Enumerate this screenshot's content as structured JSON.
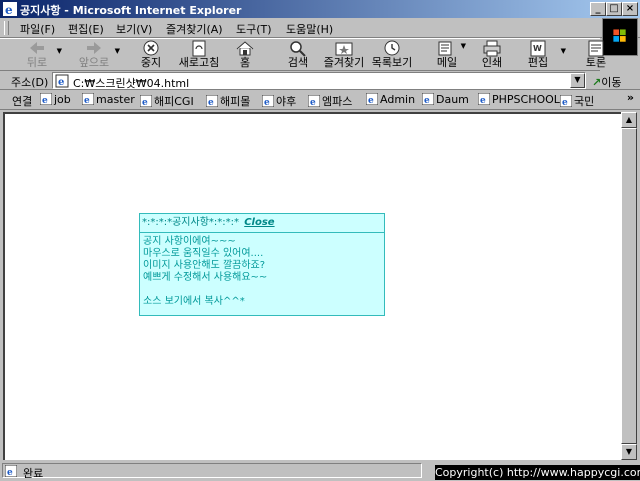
{
  "window": {
    "title": "공지사항 - Microsoft Internet Explorer",
    "minimize": "_",
    "maximize": "□",
    "close": "×"
  },
  "menu": [
    "파일(F)",
    "편집(E)",
    "보기(V)",
    "즐겨찾기(A)",
    "도구(T)",
    "도움말(H)"
  ],
  "toolbar": {
    "back": "뒤로",
    "forward": "앞으로",
    "stop": "중지",
    "refresh": "새로고침",
    "home": "홈",
    "search": "검색",
    "favorites": "즐겨찾기",
    "history": "목록보기",
    "mail": "메일",
    "print": "인쇄",
    "edit": "편집",
    "discuss": "토론"
  },
  "address": {
    "label": "주소(D)",
    "url": "C:₩스크린샷₩04.html",
    "go_label": "이동"
  },
  "links": {
    "label": "연결",
    "items": [
      "job",
      "master",
      "해피CGI",
      "해피몰",
      "야후",
      "엠파스",
      "Admin",
      "Daum",
      "PHPSCHOOL",
      "국민"
    ],
    "more": "»"
  },
  "notice": {
    "header": "*:*:*:*공지사항*:*:*:*",
    "close_label": "Close",
    "lines": [
      "공지 사항이에여~~~",
      "마우스로 움직일수 있어여....",
      "이미지 사용안해도 깔끔하죠?",
      "예쁘게 수정해서 사용해요~~",
      "",
      "소스 보기에서 복사^^*"
    ]
  },
  "status": {
    "text": "완료",
    "copyright": "Copyright(c) http://www.happycgi.com"
  },
  "colors": {
    "titlebar_start": "#0a246a",
    "titlebar_end": "#a6caf0",
    "notice_bg": "#ccffff",
    "notice_border": "#33bbbb",
    "notice_text": "#009999"
  }
}
